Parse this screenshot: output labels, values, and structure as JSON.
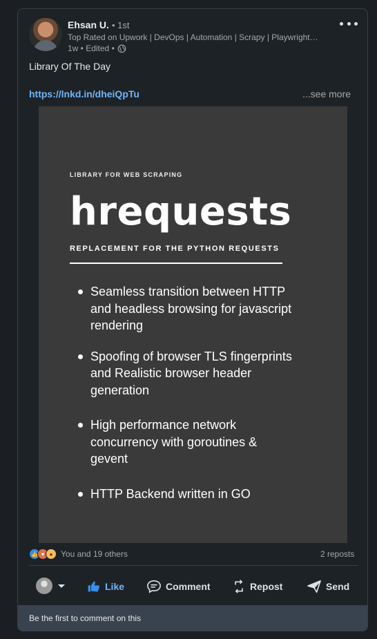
{
  "post": {
    "author": {
      "name": "Ehsan U.",
      "degree": "• 1st",
      "headline": "Top Rated on Upwork | DevOps | Automation | Scrapy | Playwright | Selenium",
      "time": "1w • Edited •"
    },
    "text": "Library Of The Day",
    "link": "https://lnkd.in/dheiQpTu",
    "see_more": "...see more"
  },
  "image": {
    "kicker": "LIBRARY FOR WEB SCRAPING",
    "title": "hrequests",
    "subtitle": "REPLACEMENT FOR THE PYTHON REQUESTS",
    "bullets": [
      "Seamless transition between HTTP and headless browsing for javascript rendering",
      "Spoofing of browser TLS fingerprints and Realistic browser header generation",
      "High performance network concurrency with goroutines & gevent",
      "HTTP Backend written in GO"
    ]
  },
  "social": {
    "reactions_text": "You and 19 others",
    "reposts": "2 reposts"
  },
  "actions": {
    "like": "Like",
    "comment": "Comment",
    "repost": "Repost",
    "send": "Send"
  },
  "comments": {
    "empty_text": "Be the first to comment on this"
  },
  "colors": {
    "accent": "#70b5f9",
    "card": "#1d2226",
    "image_bg": "#3a3a3a"
  },
  "icons": [
    "globe-icon",
    "more-icon",
    "like-icon",
    "comment-icon",
    "repost-icon",
    "send-icon",
    "chevron-down-icon"
  ]
}
